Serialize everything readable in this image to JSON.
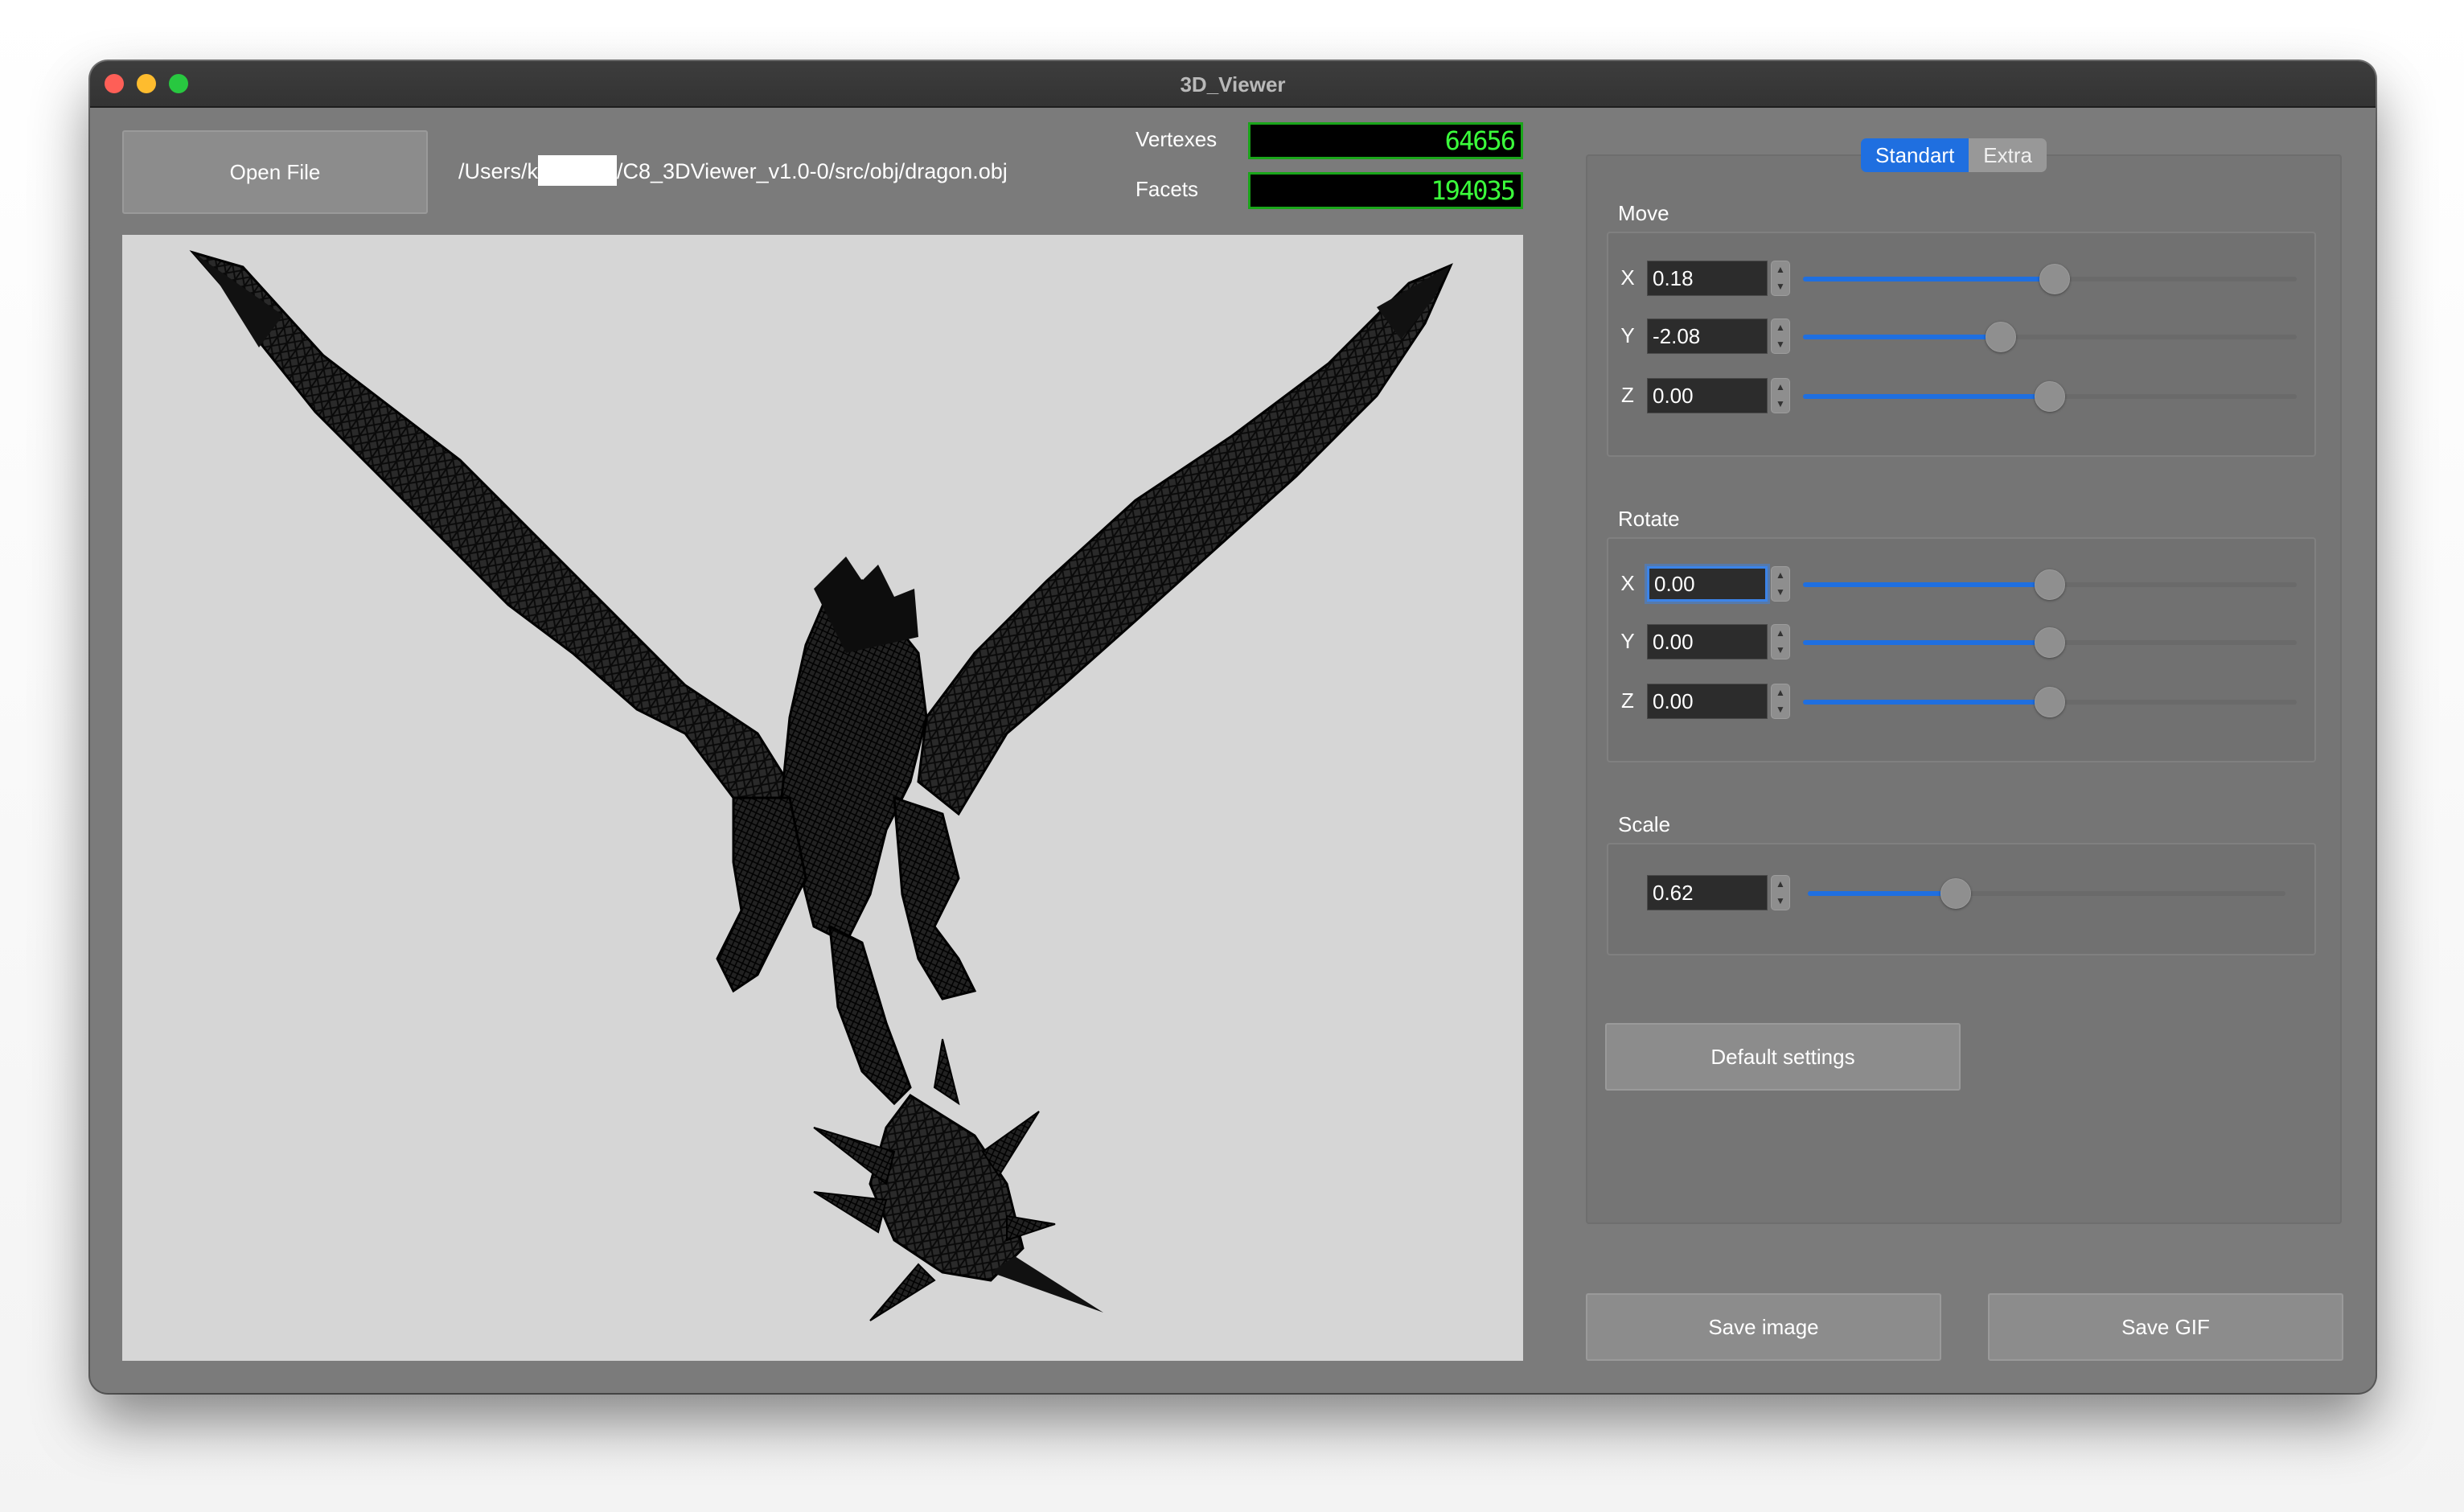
{
  "window": {
    "title": "3D_Viewer"
  },
  "toolbar": {
    "open_file_label": "Open File",
    "file_path_prefix": "/Users/k",
    "file_path_suffix": "/C8_3DViewer_v1.0-0/src/obj/dragon.obj"
  },
  "stats": {
    "vertexes_label": "Vertexes",
    "vertexes_value": "64656",
    "facets_label": "Facets",
    "facets_value": "194035"
  },
  "tabs": [
    {
      "label": "Standart",
      "active": true
    },
    {
      "label": "Extra",
      "active": false
    }
  ],
  "move": {
    "label": "Move",
    "x": {
      "axis": "X",
      "value": "0.18",
      "slider": 0.51
    },
    "y": {
      "axis": "Y",
      "value": "-2.08",
      "slider": 0.4
    },
    "z": {
      "axis": "Z",
      "value": "0.00",
      "slider": 0.5
    }
  },
  "rotate": {
    "label": "Rotate",
    "x": {
      "axis": "X",
      "value": "0.00",
      "slider": 0.5
    },
    "y": {
      "axis": "Y",
      "value": "0.00",
      "slider": 0.5
    },
    "z": {
      "axis": "Z",
      "value": "0.00",
      "slider": 0.5
    }
  },
  "scale": {
    "label": "Scale",
    "value": "0.62",
    "slider": 0.31
  },
  "buttons": {
    "default_settings": "Default settings",
    "save_image": "Save image",
    "save_gif": "Save GIF"
  },
  "colors": {
    "accent": "#1f6fe0",
    "lcd_text": "#3bff3b",
    "viewport_bg": "#d6d6d6",
    "model": "#111111"
  },
  "icons": {
    "close": "close-traffic-light-icon",
    "minimize": "minimize-traffic-light-icon",
    "zoom": "zoom-traffic-light-icon",
    "stepper_up": "chevron-up-icon",
    "stepper_down": "chevron-down-icon"
  }
}
